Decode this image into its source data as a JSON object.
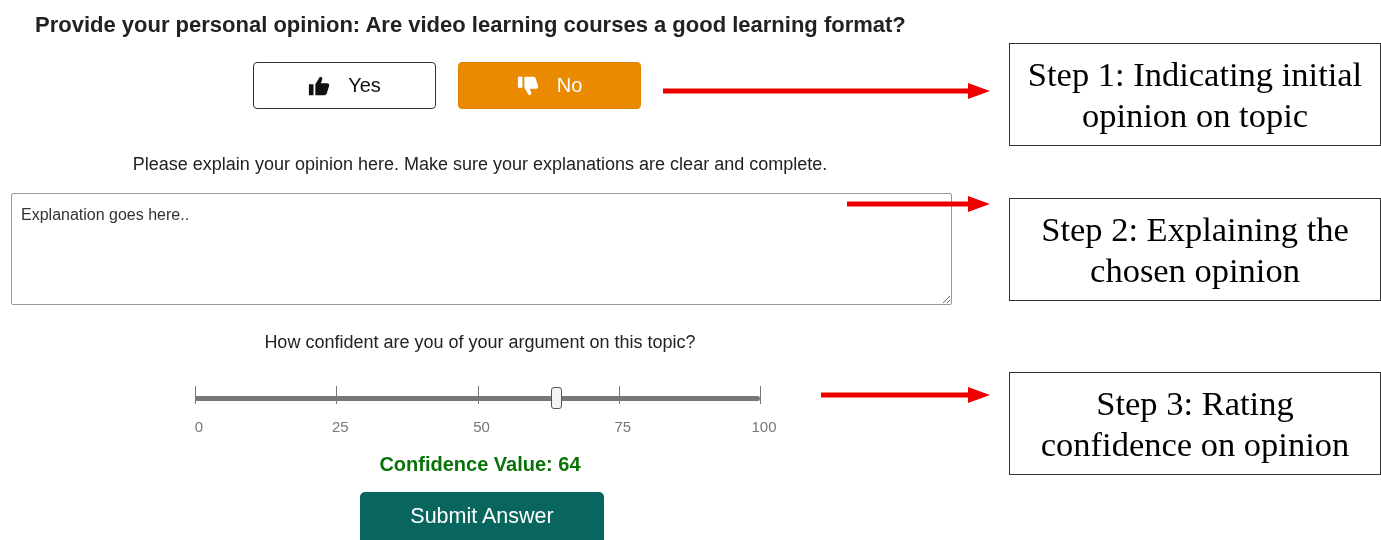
{
  "question": "Provide your personal opinion: Are video learning courses a good learning format?",
  "choices": [
    {
      "label": "Yes",
      "kind": "thumbs-up",
      "selected": false
    },
    {
      "label": "No",
      "kind": "thumbs-down",
      "selected": true
    }
  ],
  "explanation_prompt": "Please explain your opinion here. Make sure your explanations are clear and complete.",
  "explanation": {
    "placeholder": "Explanation goes here.."
  },
  "confidence_prompt": "How confident are you of your argument on this topic?",
  "slider": {
    "level": 0.64,
    "ticks": [
      "0",
      "25",
      "50",
      "75",
      "100"
    ]
  },
  "confidence_value": "Confidence Value: 64",
  "submit_button": "Submit Answer",
  "annotations": [
    {
      "lines": [
        "Step 1: Indicating initial",
        "opinion on topic"
      ]
    },
    {
      "lines": [
        "Step 2: Explaining the",
        "chosen opinion"
      ]
    },
    {
      "lines": [
        "Step 3: Rating",
        "confidence on opinion"
      ]
    }
  ]
}
